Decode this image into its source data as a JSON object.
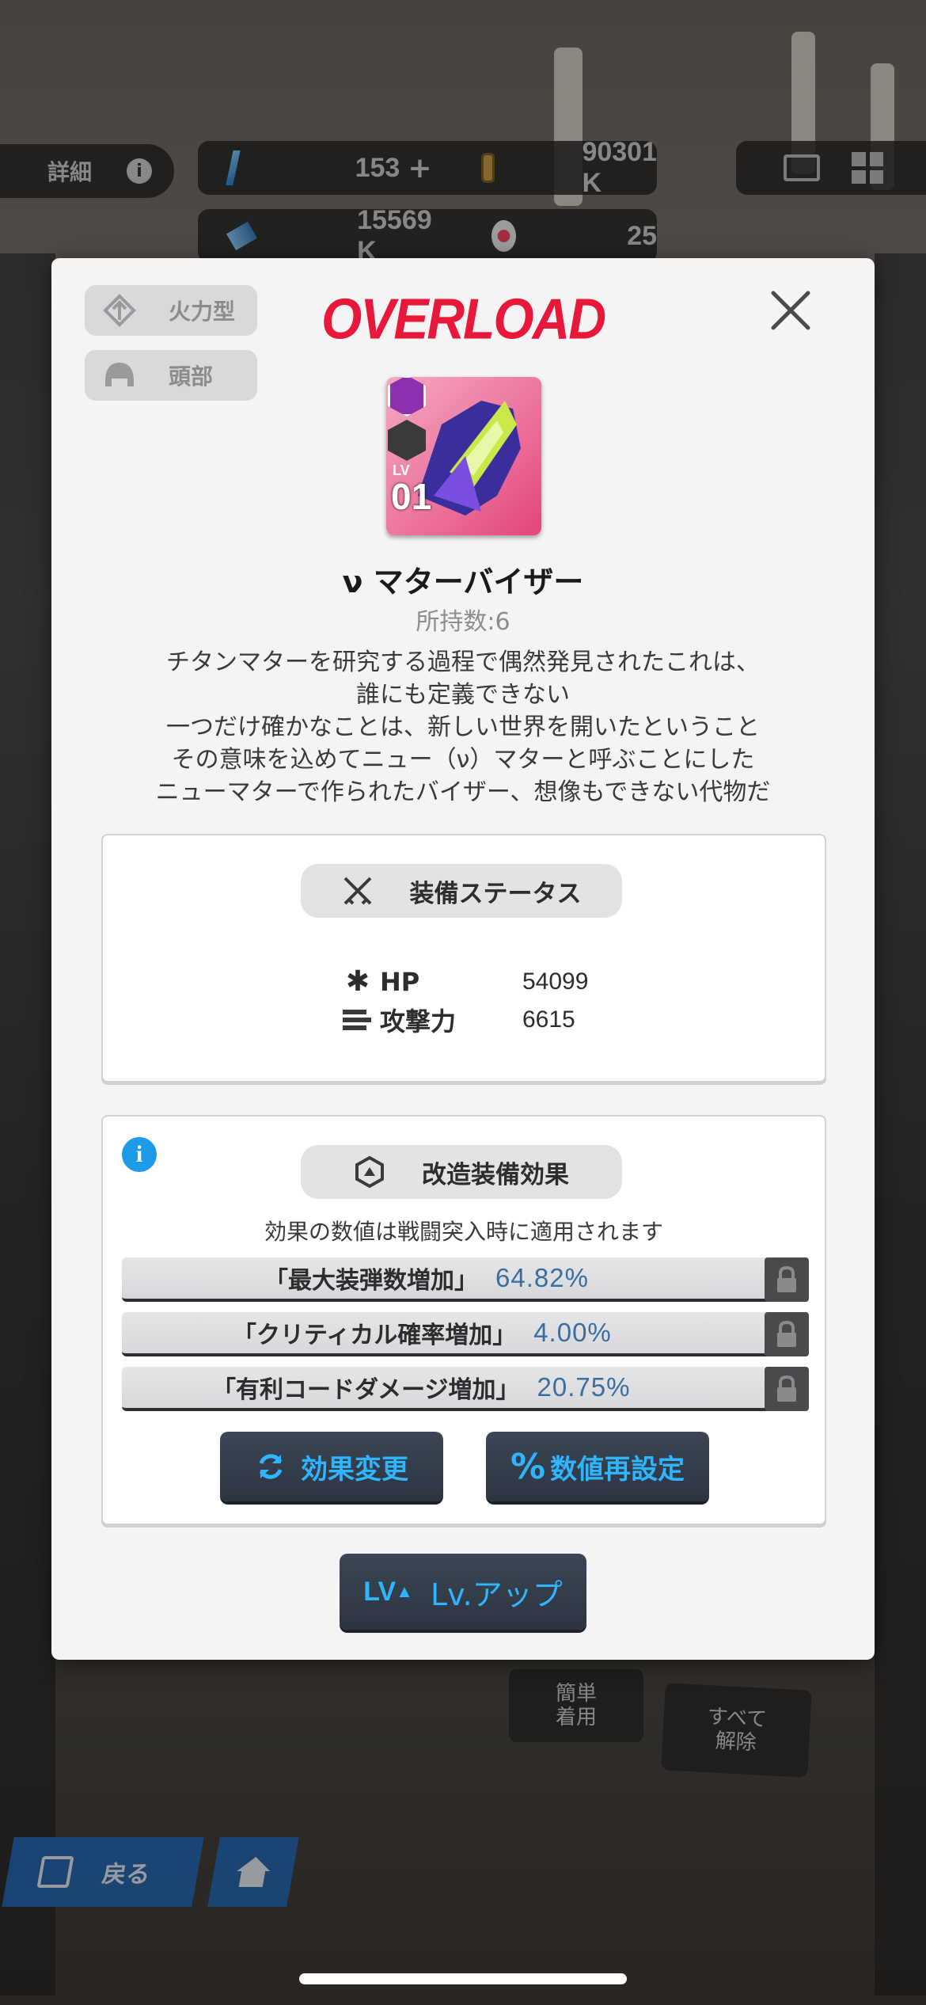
{
  "hud": {
    "detail_label": "詳細",
    "gems": "153",
    "credits": "90301 K",
    "material": "15569 K",
    "orbs": "25"
  },
  "modal": {
    "brand": "OVERLOAD",
    "type_tag": "火力型",
    "slot_tag": "頭部",
    "item_level_prefix": "LV",
    "item_level": "01",
    "item_name": "ν マターバイザー",
    "owned": "所持数:6",
    "description": [
      "チタンマターを研究する過程で偶然発見されたこれは、",
      "誰にも定義できない",
      "一つだけ確かなことは、新しい世界を開いたということ",
      "その意味を込めてニュー（ν）マターと呼ぶことにした",
      "ニューマターで作られたバイザー、想像もできない代物だ"
    ],
    "status": {
      "title": "装備ステータス",
      "hp_label": "HP",
      "hp_value": "54099",
      "atk_label": "攻撃力",
      "atk_value": "6615"
    },
    "mods": {
      "title": "改造装備効果",
      "note": "効果の数値は戦闘突入時に適用されます",
      "effects": [
        {
          "name": "「最大装弾数増加」",
          "value": "64.82%"
        },
        {
          "name": "「クリティカル確率増加」",
          "value": "4.00%"
        },
        {
          "name": "「有利コードダメージ増加」",
          "value": "20.75%"
        }
      ],
      "change_btn": "効果変更",
      "reroll_btn": "数値再設定"
    },
    "levelup_btn": "Lv.アップ",
    "levelup_icon_text": "LV"
  },
  "background": {
    "quick_equip": "簡単\n着用",
    "unequip_all": "すべて\n解除",
    "back": "戻る"
  },
  "colors": {
    "accent_red": "#e8183a",
    "button_text_blue": "#2fb5ff",
    "info_blue": "#1e9be8"
  }
}
